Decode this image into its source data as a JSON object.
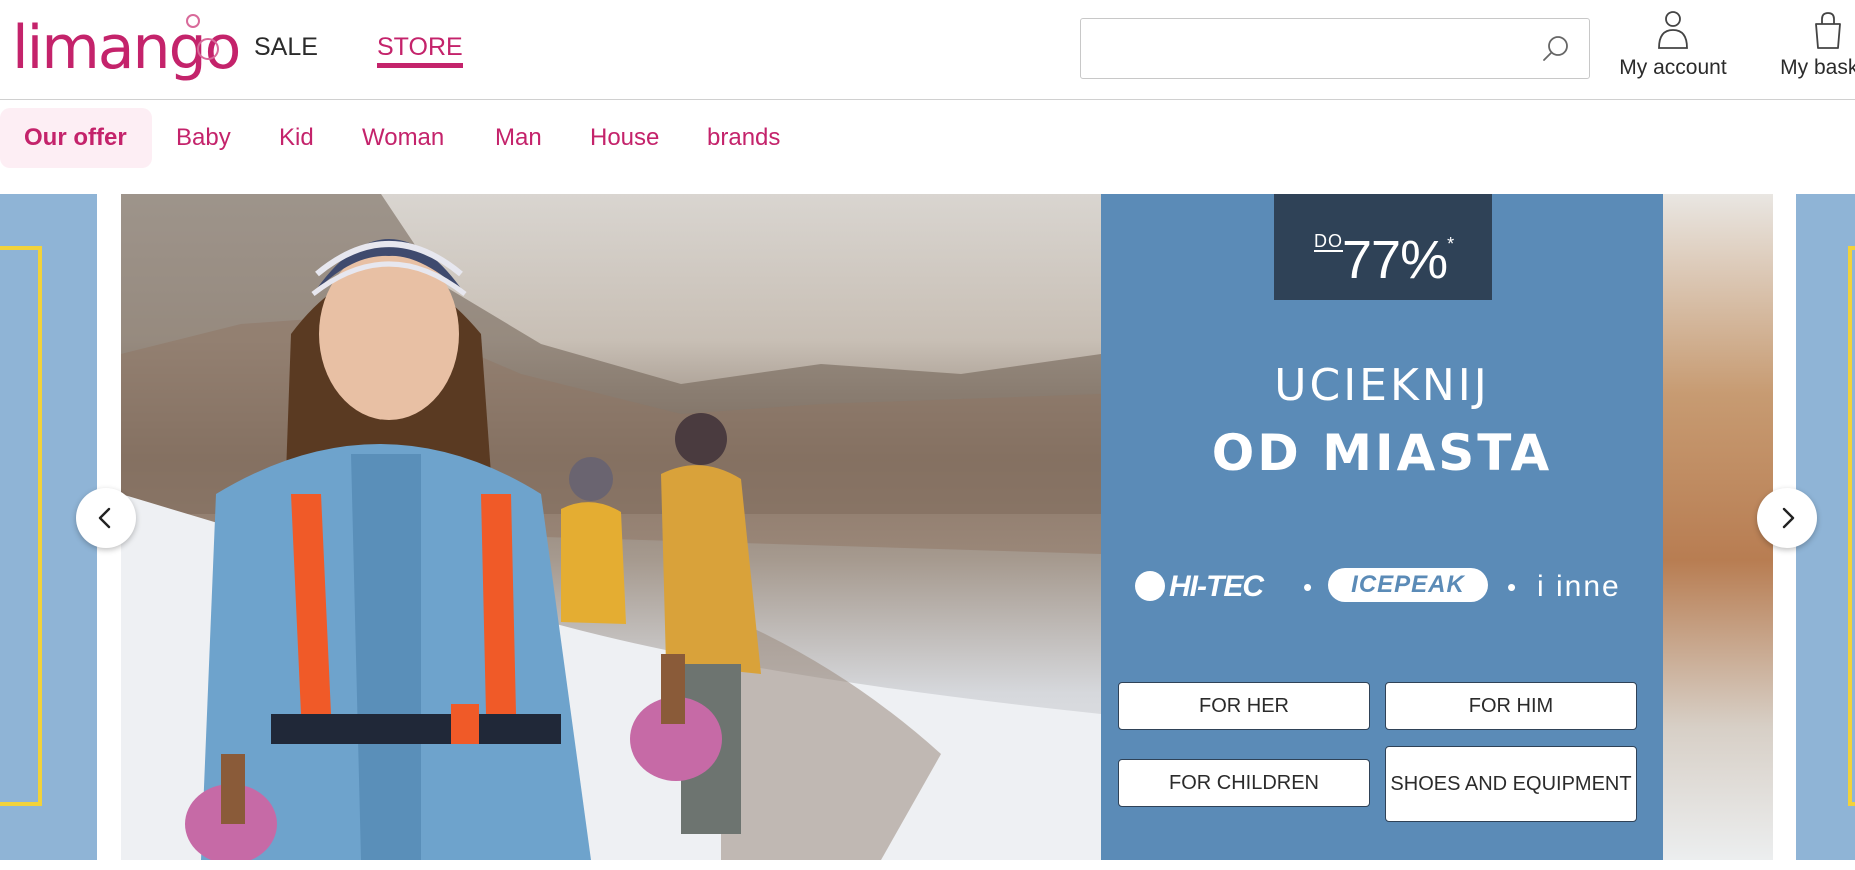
{
  "logo": {
    "text": "limango"
  },
  "top_nav": {
    "sale": "SALE",
    "store": "STORE"
  },
  "search": {
    "placeholder": "",
    "icon": "search-icon"
  },
  "header_actions": {
    "account": "My account",
    "basket": "My basket"
  },
  "categories": [
    "Our offer",
    "Baby",
    "Kid",
    "Woman",
    "Man",
    "House",
    "brands"
  ],
  "banner": {
    "promo_prefix": "DO",
    "promo_value": "77%",
    "promo_mark": "*",
    "headline_line1": "UCIEKNIJ",
    "headline_line2": "OD MIASTA",
    "brands": [
      "HI-TEC",
      "ICEPEAK",
      "i inne"
    ],
    "buttons": {
      "for_her": "FOR HER",
      "for_him": "FOR HIM",
      "for_children": "FOR CHILDREN",
      "shoes_and_equipment": "SHOES AND EQUIPMENT"
    }
  },
  "colors": {
    "brand": "#c4236b",
    "banner_panel": "#5b8bb7",
    "promo_box": "#2f4257",
    "side_slide": "#8fb4d6",
    "side_frame": "#f2d23a",
    "active_tab_bg": "#fdeef4"
  }
}
